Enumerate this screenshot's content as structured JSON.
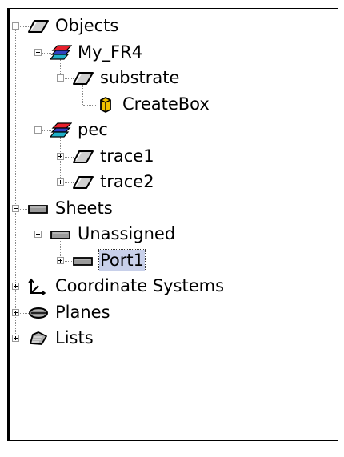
{
  "tree": [
    {
      "label": "Objects",
      "icon": "solid-object-icon",
      "level": 0,
      "toggle": "minus"
    },
    {
      "label": "My_FR4",
      "icon": "material-layers-icon",
      "level": 1,
      "toggle": "minus"
    },
    {
      "label": "substrate",
      "icon": "solid-object-icon",
      "level": 2,
      "toggle": "minus"
    },
    {
      "label": "CreateBox",
      "icon": "create-box-command-icon",
      "level": 3,
      "toggle": "none"
    },
    {
      "label": "pec",
      "icon": "material-layers-icon",
      "level": 1,
      "toggle": "minus"
    },
    {
      "label": "trace1",
      "icon": "solid-object-icon",
      "level": 2,
      "toggle": "plus"
    },
    {
      "label": "trace2",
      "icon": "solid-object-icon",
      "level": 2,
      "toggle": "plus"
    },
    {
      "label": "Sheets",
      "icon": "sheet-icon",
      "level": 0,
      "toggle": "minus"
    },
    {
      "label": "Unassigned",
      "icon": "sheet-icon",
      "level": 1,
      "toggle": "minus"
    },
    {
      "label": "Port1",
      "icon": "sheet-icon",
      "level": 2,
      "toggle": "plus",
      "selected": true
    },
    {
      "label": "Coordinate Systems",
      "icon": "coordinate-system-icon",
      "level": 0,
      "toggle": "plus"
    },
    {
      "label": "Planes",
      "icon": "planes-icon",
      "level": 0,
      "toggle": "plus"
    },
    {
      "label": "Lists",
      "icon": "lists-icon",
      "level": 0,
      "toggle": "plus"
    }
  ],
  "colors": {
    "selection": "#c8d0ea",
    "material_top": "#e8202c",
    "material_bottom": "#20b0c8",
    "material_middle": "#3040c0",
    "createbox_fill": "#f2c200"
  }
}
